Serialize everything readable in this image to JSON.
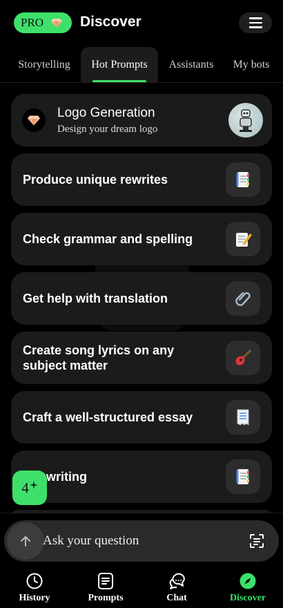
{
  "header": {
    "pro_label": "PRO",
    "title": "Discover",
    "menu_icon": "hamburger-icon"
  },
  "tabs": [
    {
      "label": "Storytelling",
      "active": false
    },
    {
      "label": "Hot Prompts",
      "active": true
    },
    {
      "label": "Assistants",
      "active": false
    },
    {
      "label": "My bots",
      "active": false
    }
  ],
  "featured": {
    "title": "Logo Generation",
    "subtitle": "Design your dream logo",
    "icon": "gem-icon"
  },
  "prompts": [
    {
      "title": "Produce unique rewrites",
      "icon": "document-icon"
    },
    {
      "title": "Check grammar and spelling",
      "icon": "memo-pencil-icon"
    },
    {
      "title": "Get help with translation",
      "icon": "paperclip-icon"
    },
    {
      "title": "Create song lyrics on any subject matter",
      "icon": "guitar-icon"
    },
    {
      "title": "Craft a well-structured essay",
      "icon": "receipt-icon"
    },
    {
      "title": "lize writing",
      "icon": "document-icon"
    }
  ],
  "fab": {
    "label": "4",
    "icon": "sparkle-icon"
  },
  "ask": {
    "placeholder": "Ask your question"
  },
  "nav": [
    {
      "label": "History",
      "icon": "clock-icon",
      "active": false
    },
    {
      "label": "Prompts",
      "icon": "prompts-icon",
      "active": false
    },
    {
      "label": "Chat",
      "icon": "chat-icon",
      "active": false
    },
    {
      "label": "Discover",
      "icon": "compass-icon",
      "active": true
    }
  ],
  "colors": {
    "accent": "#3ee06a",
    "background": "#000000",
    "card": "#1b1b1b"
  }
}
